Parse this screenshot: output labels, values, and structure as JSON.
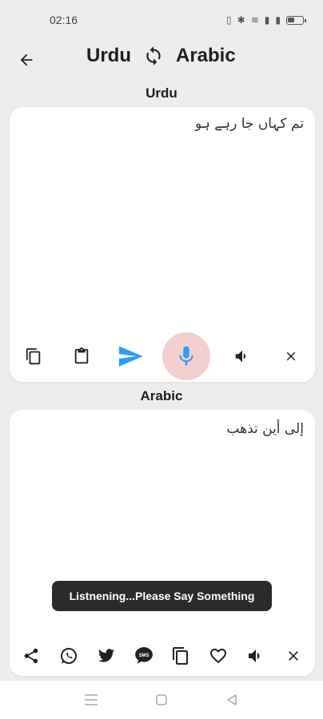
{
  "status_bar": {
    "time": "02:16"
  },
  "header": {
    "source_language": "Urdu",
    "target_language": "Arabic"
  },
  "source_panel": {
    "label": "Urdu",
    "text": "تم کہاں جا رہے ہو",
    "tools": [
      "copy-icon",
      "paste-icon",
      "send-icon",
      "mic-icon",
      "speaker-icon",
      "close-icon"
    ]
  },
  "target_panel": {
    "label": "Arabic",
    "text": "إلى أين تذهب",
    "tools": [
      "share-icon",
      "whatsapp-icon",
      "twitter-icon",
      "sms-icon",
      "copy-icon",
      "heart-icon",
      "speaker-icon",
      "close-icon"
    ]
  },
  "toast": {
    "message": "Listnening...Please Say Something"
  },
  "colors": {
    "accent_blue": "#2f9df2",
    "mic_highlight": "#f3cfcf",
    "background": "#ededed",
    "card": "#ffffff"
  }
}
